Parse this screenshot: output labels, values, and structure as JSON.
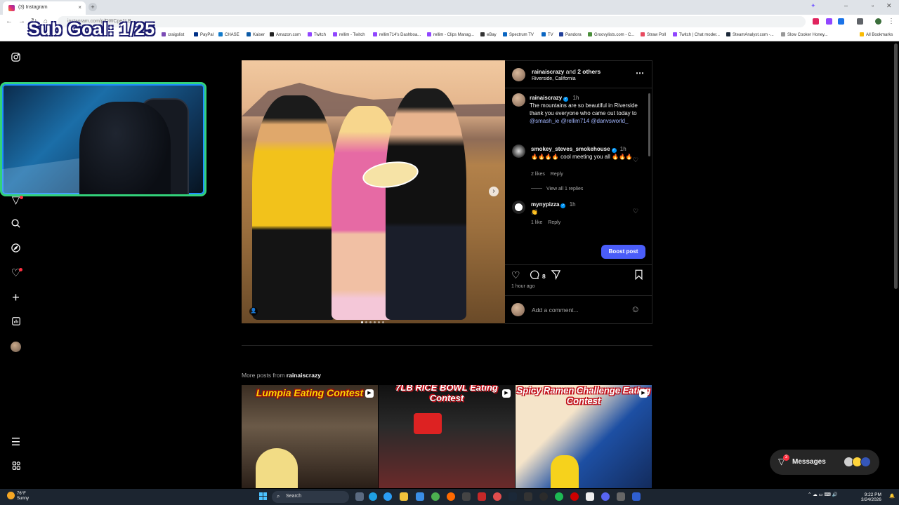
{
  "browser": {
    "tab_title": "(3) Instagram",
    "url": "instagram.com/p/DWCpe1LB...",
    "bookmarks": [
      "Sub Goal",
      "craigslist",
      "PayPal",
      "CHASE",
      "Kaiser",
      "Amazon.com",
      "Twitch",
      "rellim - Twitch",
      "rellim714's Dashboa...",
      "rellim - Clips Manag...",
      "eBay",
      "Spectrum TV",
      "TV",
      "Pandora",
      "Groovylists.com - C...",
      "Straw Poll",
      "Twitch | Chat moder...",
      "SteamAnalyst.com -...",
      "Slow Cooker Honey...",
      "All Bookmarks"
    ],
    "all_bookmarks": "All Bookmarks"
  },
  "overlay": {
    "sub_goal": "Sub Goal: 1/25"
  },
  "sidebar": {
    "icons": [
      "instagram-logo-icon",
      "reels-icon",
      "search-icon",
      "explore-icon",
      "notifications-heart-icon",
      "create-plus-icon",
      "dashboard-icon",
      "profile-avatar",
      "more-menu-icon",
      "also-from-meta-icon"
    ]
  },
  "post": {
    "header": {
      "username": "rainaiscrazy",
      "and_text": "and",
      "others": "2 others",
      "location": "Riverside, California"
    },
    "caption": {
      "username": "rainaiscrazy",
      "time": "1h",
      "text": "The mountains are so beautiful in Riverside thank you everyone who came out today to",
      "mention1": "@smash_ie",
      "mention2": "@rellim714",
      "mention3": "@danvsworld_"
    },
    "comments": [
      {
        "username": "smokey_steves_smokehouse",
        "time": "1h",
        "text": "🔥🔥🔥🔥 cool meeting you all 🔥🔥🔥",
        "likes": "2 likes",
        "reply": "Reply",
        "view_replies": "View all 1 replies"
      },
      {
        "username": "mynypizza",
        "time": "1h",
        "text": "👏",
        "likes": "1 like",
        "reply": "Reply"
      }
    ],
    "boost_label": "Boost post",
    "comment_count": "8",
    "timestamp": "1 hour ago",
    "comment_placeholder": "Add a comment..."
  },
  "more_posts": {
    "prefix": "More posts from",
    "username": "rainaiscrazy",
    "thumbs": [
      {
        "title": "Lumpia Eating Contest"
      },
      {
        "title": "7LB RICE BOWL Eating Contest"
      },
      {
        "title": "Spicy Ramen Challenge Eating Contest"
      }
    ]
  },
  "messages": {
    "label": "Messages",
    "badge": "3"
  },
  "taskbar": {
    "temp": "76°F",
    "condition": "Sunny",
    "search_placeholder": "Search",
    "time": "9:22 PM",
    "date": "3/24/2026"
  },
  "colors": {
    "accent_blue": "#4a5df9",
    "verified": "#0095f6",
    "notification_red": "#ff3040",
    "link": "#a3b7ff"
  }
}
